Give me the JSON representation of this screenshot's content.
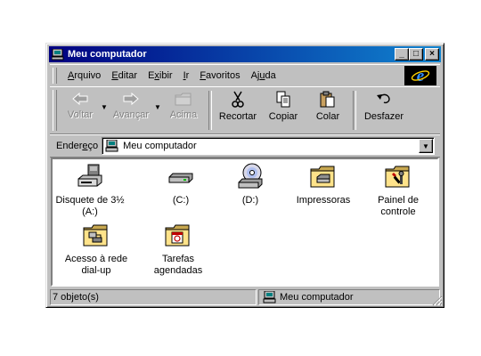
{
  "window": {
    "title": "Meu computador",
    "controls": {
      "minimize": "_",
      "maximize": "□",
      "close": "×"
    }
  },
  "menu": {
    "items": [
      {
        "pre": "",
        "key": "A",
        "post": "rquivo"
      },
      {
        "pre": "",
        "key": "E",
        "post": "ditar"
      },
      {
        "pre": "E",
        "key": "x",
        "post": "ibir"
      },
      {
        "pre": "",
        "key": "I",
        "post": "r"
      },
      {
        "pre": "",
        "key": "F",
        "post": "avoritos"
      },
      {
        "pre": "Aj",
        "key": "u",
        "post": "da"
      }
    ]
  },
  "toolbar": {
    "back": "Voltar",
    "forward": "Avançar",
    "up": "Acima",
    "cut": "Recortar",
    "copy": "Copiar",
    "paste": "Colar",
    "undo": "Desfazer"
  },
  "address": {
    "label_pre": "Ender",
    "label_key": "e",
    "label_post": "ço",
    "value": "Meu computador"
  },
  "items": [
    {
      "label": "Disquete de 3½ (A:)",
      "icon": "floppy-drive-icon"
    },
    {
      "label": "(C:)",
      "icon": "hard-drive-icon"
    },
    {
      "label": "(D:)",
      "icon": "cd-drive-icon"
    },
    {
      "label": "Impressoras",
      "icon": "printers-folder-icon"
    },
    {
      "label": "Painel de controle",
      "icon": "control-panel-folder-icon"
    },
    {
      "label": "Acesso à rede dial-up",
      "icon": "dial-up-networking-folder-icon"
    },
    {
      "label": "Tarefas agendadas",
      "icon": "scheduled-tasks-folder-icon"
    }
  ],
  "status": {
    "count": "7 objeto(s)",
    "location": "Meu computador"
  },
  "colors": {
    "titlebar_start": "#000080",
    "titlebar_end": "#1084d0",
    "face": "#c0c0c0",
    "folder": "#ffe38a"
  }
}
